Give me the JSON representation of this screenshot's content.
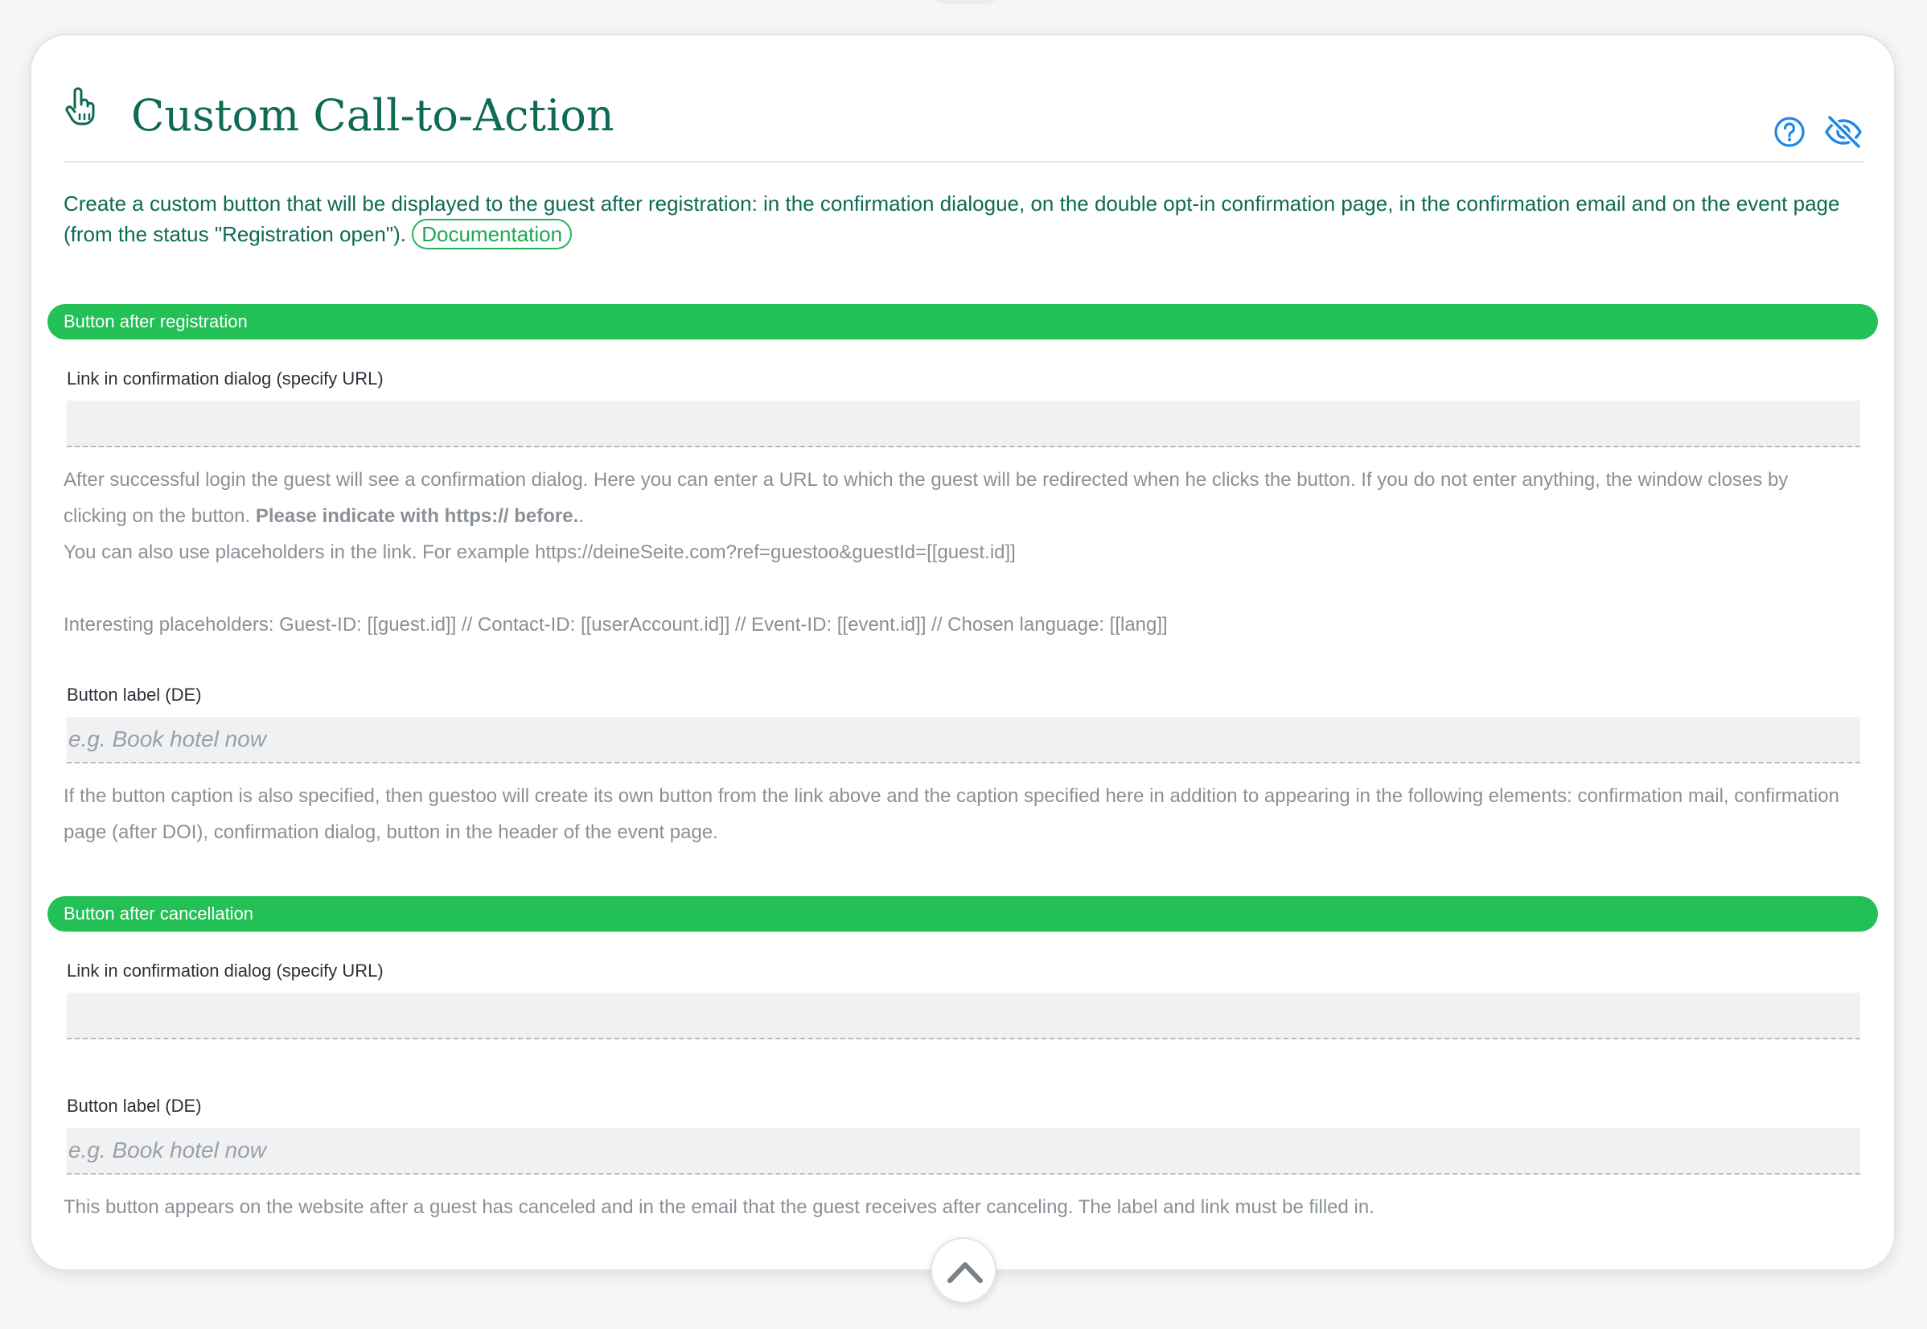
{
  "card": {
    "title": "Custom Call-to-Action",
    "title_icon": "pointing-hand-icon",
    "actions": [
      {
        "icon": "help-circle-icon"
      },
      {
        "icon": "eye-off-icon"
      }
    ],
    "intro_text": "Create a custom button that will be displayed to the guest after registration: in the confirmation dialogue, on the double opt-in confirmation page, in the confirmation email and on the event page (from the status \"Registration open\").",
    "documentation_label": "Documentation"
  },
  "section_registration": {
    "title": "Button after registration",
    "link_label": "Link in confirmation dialog (specify URL)",
    "link_value": "",
    "link_help_1": "After successful login the guest will see a confirmation dialog. Here you can enter a URL to which the guest will be redirected when he clicks the button. If you do not enter anything, the window closes by clicking on the button.",
    "link_help_bold": "Please indicate with https:// before.",
    "link_help_1_end": ".",
    "link_help_2": "You can also use placeholders in the link. For example https://deineSeite.com?ref=guestoo&guestId=[[guest.id]]",
    "link_help_3": "Interesting placeholders: Guest-ID: [[guest.id]] // Contact-ID: [[userAccount.id]] // Event-ID: [[event.id]] // Chosen language: [[lang]]",
    "button_label": "Button label (DE)",
    "button_placeholder": "e.g. Book hotel now",
    "button_help": "If the button caption is also specified, then guestoo will create its own button from the link above and the caption specified here in addition to appearing in the following elements: confirmation mail, confirmation page (after DOI), confirmation dialog, button in the header of the event page."
  },
  "section_cancellation": {
    "title": "Button after cancellation",
    "link_label": "Link in confirmation dialog (specify URL)",
    "link_value": "",
    "button_label": "Button label (DE)",
    "button_placeholder": "e.g. Book hotel now",
    "button_help": "This button appears on the website after a guest has canceled and in the email that the guest receives after canceling. The label and link must be filled in."
  },
  "colors": {
    "accent_green": "#22c055",
    "title_teal": "#0e6a55",
    "icon_blue": "#1e88e5",
    "help_grey": "#8a9096"
  },
  "collapse_icon": "chevron-up-icon"
}
